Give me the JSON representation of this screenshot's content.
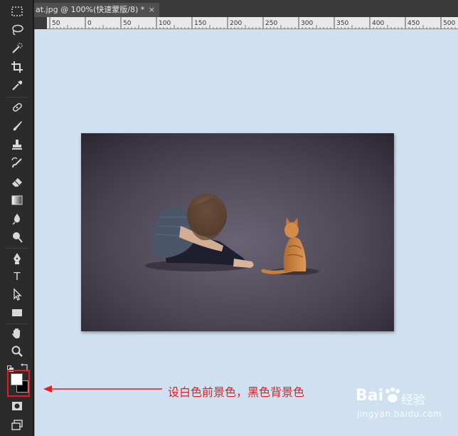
{
  "document_tab": {
    "title": "at.jpg @ 100%(快速蒙版/8) *",
    "close_glyph": "×"
  },
  "ruler": {
    "ticks": [
      "50",
      "0",
      "50",
      "100",
      "150",
      "200",
      "250",
      "300",
      "350",
      "400",
      "450",
      "500",
      "550",
      "600"
    ]
  },
  "toolbar": {
    "tools": [
      "marquee-icon",
      "lasso-icon",
      "quick-selection-icon",
      "crop-icon",
      "eyedropper-icon",
      "healing-brush-icon",
      "brush-icon",
      "clone-stamp-icon",
      "history-brush-icon",
      "eraser-icon",
      "gradient-icon",
      "blur-icon",
      "dodge-icon",
      "pen-icon",
      "type-icon",
      "path-selection-icon",
      "rectangle-icon",
      "hand-icon",
      "zoom-icon"
    ],
    "type_tool_glyph": "T",
    "foreground_color": "#ffffff",
    "background_color": "#000000",
    "highlight_color": "#e01c1c"
  },
  "annotation": {
    "text": "设白色前景色，黑色背景色",
    "color": "#e21e1e"
  },
  "watermark": {
    "brand": "Bai",
    "brand_suffix": "经验",
    "url": "jingyan.baidu.com"
  },
  "colors": {
    "workspace_bg": "#cfe0f1",
    "panel_bg": "#2b2b2b"
  }
}
